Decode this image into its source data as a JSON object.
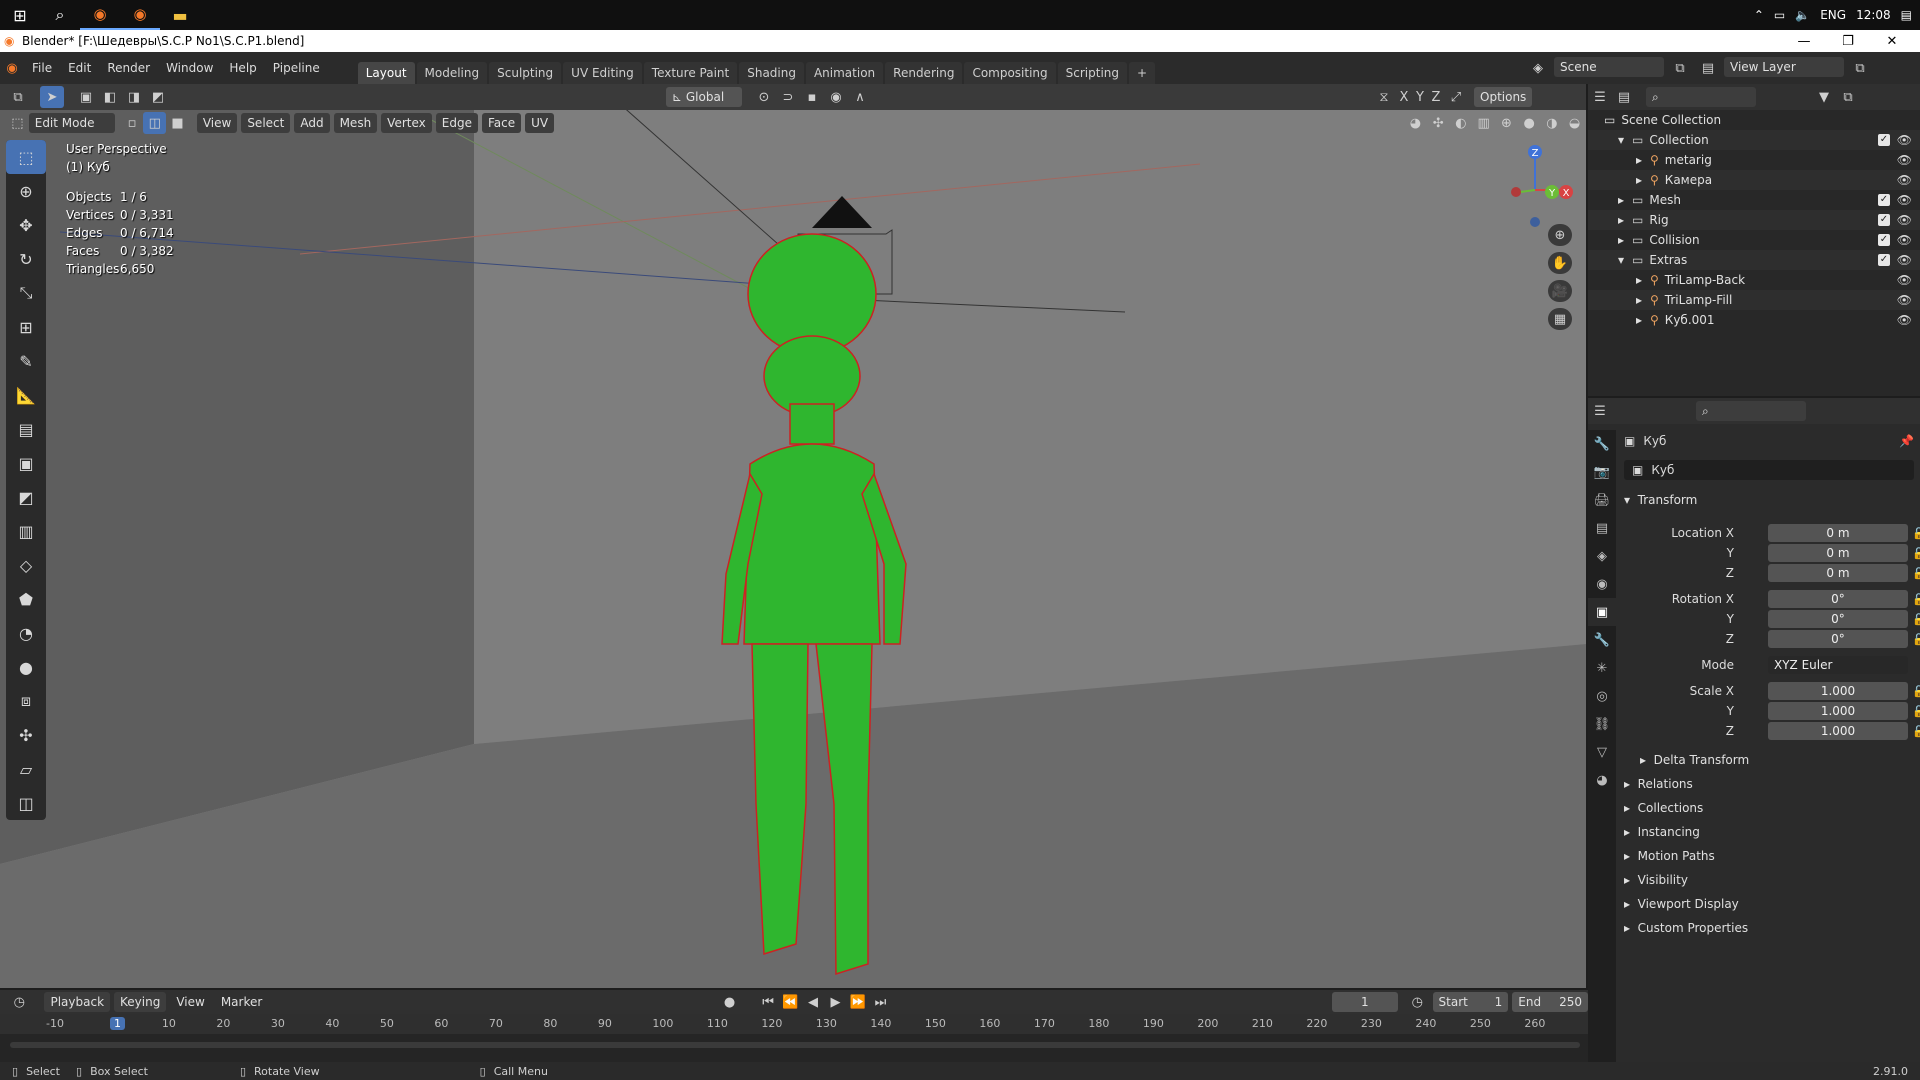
{
  "taskbar": {
    "lang": "ENG",
    "time": "12:08"
  },
  "title": "Blender* [F:\\Шедевры\\S.C.P No1\\S.C.P1.blend]",
  "menu": [
    "File",
    "Edit",
    "Render",
    "Window",
    "Help",
    "Pipeline"
  ],
  "workspaces": [
    "Layout",
    "Modeling",
    "Sculpting",
    "UV Editing",
    "Texture Paint",
    "Shading",
    "Animation",
    "Rendering",
    "Compositing",
    "Scripting"
  ],
  "active_workspace": "Layout",
  "scene": "Scene",
  "view_layer": "View Layer",
  "viewport": {
    "transform_orientation": "Global",
    "options": "Options",
    "mode": "Edit Mode",
    "header_menus": [
      "View",
      "Select",
      "Add",
      "Mesh",
      "Vertex",
      "Edge",
      "Face",
      "UV"
    ],
    "axes": [
      "X",
      "Y",
      "Z"
    ],
    "perspective": "User Perspective",
    "object_name": "(1) Куб",
    "stats": [
      {
        "k": "Objects",
        "v": "1 / 6"
      },
      {
        "k": "Vertices",
        "v": "0 / 3,331"
      },
      {
        "k": "Edges",
        "v": "0 / 6,714"
      },
      {
        "k": "Faces",
        "v": "0 / 3,382"
      },
      {
        "k": "Triangles",
        "v": "6,650"
      }
    ],
    "gizmo_axes": [
      "Z",
      "Y",
      "X"
    ]
  },
  "outliner": {
    "root": "Scene Collection",
    "rows": [
      {
        "label": "Collection",
        "indent": 1,
        "expanded": true,
        "checked": true
      },
      {
        "label": "metarig",
        "indent": 2,
        "checked": false
      },
      {
        "label": "Камера",
        "indent": 2,
        "checked": false
      },
      {
        "label": "Mesh",
        "indent": 1,
        "checked": true
      },
      {
        "label": "Rig",
        "indent": 1,
        "checked": true
      },
      {
        "label": "Collision",
        "indent": 1,
        "checked": true
      },
      {
        "label": "Extras",
        "indent": 1,
        "expanded": true,
        "checked": true
      },
      {
        "label": "TriLamp-Back",
        "indent": 2,
        "checked": false
      },
      {
        "label": "TriLamp-Fill",
        "indent": 2,
        "checked": false
      },
      {
        "label": "Куб.001",
        "indent": 2,
        "checked": false
      }
    ]
  },
  "properties": {
    "object": "Куб",
    "object_field": "Куб",
    "transform_title": "Transform",
    "location": {
      "label": "Location X",
      "x": "0 m",
      "y": "0 m",
      "z": "0 m"
    },
    "rotation": {
      "label": "Rotation X",
      "x": "0°",
      "y": "0°",
      "z": "0°"
    },
    "mode_label": "Mode",
    "mode_value": "XYZ Euler",
    "scale": {
      "label": "Scale X",
      "x": "1.000",
      "y": "1.000",
      "z": "1.000"
    },
    "axis_y": "Y",
    "axis_z": "Z",
    "delta": "Delta Transform",
    "panels": [
      "Relations",
      "Collections",
      "Instancing",
      "Motion Paths",
      "Visibility",
      "Viewport Display",
      "Custom Properties"
    ]
  },
  "timeline": {
    "menus": [
      "Playback",
      "Keying",
      "View",
      "Marker"
    ],
    "current_frame": "1",
    "start_label": "Start",
    "start": "1",
    "end_label": "End",
    "end": "250",
    "ruler": [
      "-10",
      "1",
      "10",
      "20",
      "30",
      "40",
      "50",
      "60",
      "70",
      "80",
      "90",
      "100",
      "110",
      "120",
      "130",
      "140",
      "150",
      "160",
      "170",
      "180",
      "190",
      "200",
      "210",
      "220",
      "230",
      "240",
      "250",
      "260"
    ],
    "frame_marker": "1"
  },
  "status": {
    "select": "Select",
    "box_select": "Box Select",
    "rotate": "Rotate View",
    "call_menu": "Call Menu",
    "version": "2.91.0"
  }
}
